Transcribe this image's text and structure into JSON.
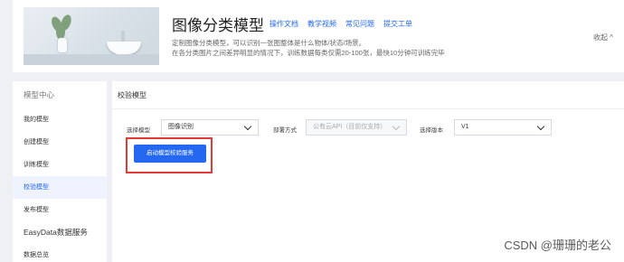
{
  "header": {
    "title": "图像分类模型",
    "links": [
      "操作文档",
      "教学视频",
      "常见问题",
      "提交工单"
    ],
    "desc_line1": "定制图像分类模型，可以识别一张图整体是什么物体/状态/场景。",
    "desc_line2": "在各分类图片之间差异明显的情况下，训练数据每类仅需20-100张，最快10分钟可训练完毕",
    "collapse_label": "收起 ^"
  },
  "sidebar": {
    "items": [
      {
        "label": "模型中心"
      },
      {
        "label": "我的模型"
      },
      {
        "label": "创建模型"
      },
      {
        "label": "训练模型"
      },
      {
        "label": "校验模型"
      },
      {
        "label": "发布模型"
      },
      {
        "label": "EasyData数据服务"
      },
      {
        "label": "数据总览"
      }
    ]
  },
  "main": {
    "panel_title": "校验模型",
    "form": {
      "model_label": "选择模型",
      "model_value": "图像识别",
      "deploy_label": "部署方式",
      "deploy_value": "公有云API（目前仅支持）",
      "version_label": "选择版本",
      "version_value": "V1"
    },
    "start_button": "启动模型校验服务"
  },
  "watermark": "CSDN @珊珊的老公",
  "colors": {
    "accent": "#2468f2",
    "highlight_border": "#e53935"
  }
}
